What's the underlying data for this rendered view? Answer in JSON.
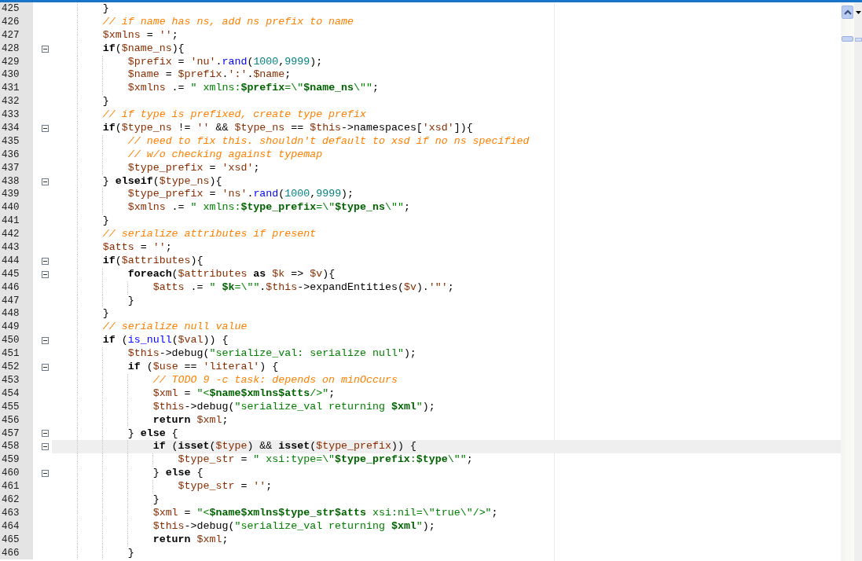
{
  "editor": {
    "lines": [
      {
        "number": "425",
        "fold": false,
        "highlighted": false,
        "tokens": [
          {
            "kind": "plain",
            "text": "        }"
          }
        ]
      },
      {
        "number": "426",
        "fold": false,
        "highlighted": false,
        "tokens": [
          {
            "kind": "comment",
            "text": "        // if name has ns, add ns prefix to name"
          }
        ]
      },
      {
        "number": "427",
        "fold": false,
        "highlighted": false,
        "tokens": [
          {
            "kind": "variable",
            "text": "        $xmlns"
          },
          {
            "kind": "plain",
            "text": " = "
          },
          {
            "kind": "string",
            "text": "''"
          },
          {
            "kind": "plain",
            "text": ";"
          }
        ]
      },
      {
        "number": "428",
        "fold": true,
        "highlighted": false,
        "tokens": [
          {
            "kind": "keyword",
            "text": "        if"
          },
          {
            "kind": "plain",
            "text": "("
          },
          {
            "kind": "variable",
            "text": "$name_ns"
          },
          {
            "kind": "plain",
            "text": "){"
          }
        ]
      },
      {
        "number": "429",
        "fold": false,
        "highlighted": false,
        "tokens": [
          {
            "kind": "variable",
            "text": "            $prefix"
          },
          {
            "kind": "plain",
            "text": " = "
          },
          {
            "kind": "string",
            "text": "'nu'"
          },
          {
            "kind": "plain",
            "text": "."
          },
          {
            "kind": "function",
            "text": "rand"
          },
          {
            "kind": "plain",
            "text": "("
          },
          {
            "kind": "number",
            "text": "1000"
          },
          {
            "kind": "plain",
            "text": ","
          },
          {
            "kind": "number",
            "text": "9999"
          },
          {
            "kind": "plain",
            "text": ");"
          }
        ]
      },
      {
        "number": "430",
        "fold": false,
        "highlighted": false,
        "tokens": [
          {
            "kind": "variable",
            "text": "            $name"
          },
          {
            "kind": "plain",
            "text": " = "
          },
          {
            "kind": "variable",
            "text": "$prefix"
          },
          {
            "kind": "plain",
            "text": "."
          },
          {
            "kind": "string",
            "text": "':'"
          },
          {
            "kind": "plain",
            "text": "."
          },
          {
            "kind": "variable",
            "text": "$name"
          },
          {
            "kind": "plain",
            "text": ";"
          }
        ]
      },
      {
        "number": "431",
        "fold": false,
        "highlighted": false,
        "tokens": [
          {
            "kind": "variable",
            "text": "            $xmlns"
          },
          {
            "kind": "plain",
            "text": " .= "
          },
          {
            "kind": "dstring",
            "text": "\" xmlns:"
          },
          {
            "kind": "interp",
            "text": "$prefix"
          },
          {
            "kind": "dstring",
            "text": "=\\\""
          },
          {
            "kind": "interp",
            "text": "$name_ns"
          },
          {
            "kind": "dstring",
            "text": "\\\"\""
          },
          {
            "kind": "plain",
            "text": ";"
          }
        ]
      },
      {
        "number": "432",
        "fold": false,
        "highlighted": false,
        "tokens": [
          {
            "kind": "plain",
            "text": "        }"
          }
        ]
      },
      {
        "number": "433",
        "fold": false,
        "highlighted": false,
        "tokens": [
          {
            "kind": "comment",
            "text": "        // if type is prefixed, create type prefix"
          }
        ]
      },
      {
        "number": "434",
        "fold": true,
        "highlighted": false,
        "tokens": [
          {
            "kind": "keyword",
            "text": "        if"
          },
          {
            "kind": "plain",
            "text": "("
          },
          {
            "kind": "variable",
            "text": "$type_ns"
          },
          {
            "kind": "plain",
            "text": " != "
          },
          {
            "kind": "string",
            "text": "''"
          },
          {
            "kind": "plain",
            "text": " && "
          },
          {
            "kind": "variable",
            "text": "$type_ns"
          },
          {
            "kind": "plain",
            "text": " == "
          },
          {
            "kind": "variable",
            "text": "$this"
          },
          {
            "kind": "plain",
            "text": "->namespaces["
          },
          {
            "kind": "string",
            "text": "'xsd'"
          },
          {
            "kind": "plain",
            "text": "]){"
          }
        ]
      },
      {
        "number": "435",
        "fold": false,
        "highlighted": false,
        "tokens": [
          {
            "kind": "comment",
            "text": "            // need to fix this. shouldn't default to xsd if no ns specified"
          }
        ]
      },
      {
        "number": "436",
        "fold": false,
        "highlighted": false,
        "tokens": [
          {
            "kind": "comment",
            "text": "            // w/o checking against typemap"
          }
        ]
      },
      {
        "number": "437",
        "fold": false,
        "highlighted": false,
        "tokens": [
          {
            "kind": "variable",
            "text": "            $type_prefix"
          },
          {
            "kind": "plain",
            "text": " = "
          },
          {
            "kind": "string",
            "text": "'xsd'"
          },
          {
            "kind": "plain",
            "text": ";"
          }
        ]
      },
      {
        "number": "438",
        "fold": true,
        "highlighted": false,
        "tokens": [
          {
            "kind": "plain",
            "text": "        } "
          },
          {
            "kind": "keyword",
            "text": "elseif"
          },
          {
            "kind": "plain",
            "text": "("
          },
          {
            "kind": "variable",
            "text": "$type_ns"
          },
          {
            "kind": "plain",
            "text": "){"
          }
        ]
      },
      {
        "number": "439",
        "fold": false,
        "highlighted": false,
        "tokens": [
          {
            "kind": "variable",
            "text": "            $type_prefix"
          },
          {
            "kind": "plain",
            "text": " = "
          },
          {
            "kind": "string",
            "text": "'ns'"
          },
          {
            "kind": "plain",
            "text": "."
          },
          {
            "kind": "function",
            "text": "rand"
          },
          {
            "kind": "plain",
            "text": "("
          },
          {
            "kind": "number",
            "text": "1000"
          },
          {
            "kind": "plain",
            "text": ","
          },
          {
            "kind": "number",
            "text": "9999"
          },
          {
            "kind": "plain",
            "text": ");"
          }
        ]
      },
      {
        "number": "440",
        "fold": false,
        "highlighted": false,
        "tokens": [
          {
            "kind": "variable",
            "text": "            $xmlns"
          },
          {
            "kind": "plain",
            "text": " .= "
          },
          {
            "kind": "dstring",
            "text": "\" xmlns:"
          },
          {
            "kind": "interp",
            "text": "$type_prefix"
          },
          {
            "kind": "dstring",
            "text": "=\\\""
          },
          {
            "kind": "interp",
            "text": "$type_ns"
          },
          {
            "kind": "dstring",
            "text": "\\\"\""
          },
          {
            "kind": "plain",
            "text": ";"
          }
        ]
      },
      {
        "number": "441",
        "fold": false,
        "highlighted": false,
        "tokens": [
          {
            "kind": "plain",
            "text": "        }"
          }
        ]
      },
      {
        "number": "442",
        "fold": false,
        "highlighted": false,
        "tokens": [
          {
            "kind": "comment",
            "text": "        // serialize attributes if present"
          }
        ]
      },
      {
        "number": "443",
        "fold": false,
        "highlighted": false,
        "tokens": [
          {
            "kind": "variable",
            "text": "        $atts"
          },
          {
            "kind": "plain",
            "text": " = "
          },
          {
            "kind": "string",
            "text": "''"
          },
          {
            "kind": "plain",
            "text": ";"
          }
        ]
      },
      {
        "number": "444",
        "fold": true,
        "highlighted": false,
        "tokens": [
          {
            "kind": "keyword",
            "text": "        if"
          },
          {
            "kind": "plain",
            "text": "("
          },
          {
            "kind": "variable",
            "text": "$attributes"
          },
          {
            "kind": "plain",
            "text": "){"
          }
        ]
      },
      {
        "number": "445",
        "fold": true,
        "highlighted": false,
        "tokens": [
          {
            "kind": "keyword",
            "text": "            foreach"
          },
          {
            "kind": "plain",
            "text": "("
          },
          {
            "kind": "variable",
            "text": "$attributes"
          },
          {
            "kind": "keyword",
            "text": " as "
          },
          {
            "kind": "variable",
            "text": "$k"
          },
          {
            "kind": "plain",
            "text": " => "
          },
          {
            "kind": "variable",
            "text": "$v"
          },
          {
            "kind": "plain",
            "text": "){"
          }
        ]
      },
      {
        "number": "446",
        "fold": false,
        "highlighted": false,
        "tokens": [
          {
            "kind": "variable",
            "text": "                $atts"
          },
          {
            "kind": "plain",
            "text": " .= "
          },
          {
            "kind": "dstring",
            "text": "\" "
          },
          {
            "kind": "interp",
            "text": "$k"
          },
          {
            "kind": "dstring",
            "text": "=\\\"\""
          },
          {
            "kind": "plain",
            "text": "."
          },
          {
            "kind": "variable",
            "text": "$this"
          },
          {
            "kind": "plain",
            "text": "->expandEntities("
          },
          {
            "kind": "variable",
            "text": "$v"
          },
          {
            "kind": "plain",
            "text": ")."
          },
          {
            "kind": "string",
            "text": "'\"'"
          },
          {
            "kind": "plain",
            "text": ";"
          }
        ]
      },
      {
        "number": "447",
        "fold": false,
        "highlighted": false,
        "tokens": [
          {
            "kind": "plain",
            "text": "            }"
          }
        ]
      },
      {
        "number": "448",
        "fold": false,
        "highlighted": false,
        "tokens": [
          {
            "kind": "plain",
            "text": "        }"
          }
        ]
      },
      {
        "number": "449",
        "fold": false,
        "highlighted": false,
        "tokens": [
          {
            "kind": "comment",
            "text": "        // serialize null value"
          }
        ]
      },
      {
        "number": "450",
        "fold": true,
        "highlighted": false,
        "tokens": [
          {
            "kind": "keyword",
            "text": "        if"
          },
          {
            "kind": "plain",
            "text": " ("
          },
          {
            "kind": "function",
            "text": "is_null"
          },
          {
            "kind": "plain",
            "text": "("
          },
          {
            "kind": "variable",
            "text": "$val"
          },
          {
            "kind": "plain",
            "text": ")) {"
          }
        ]
      },
      {
        "number": "451",
        "fold": false,
        "highlighted": false,
        "tokens": [
          {
            "kind": "variable",
            "text": "            $this"
          },
          {
            "kind": "plain",
            "text": "->debug("
          },
          {
            "kind": "dstring",
            "text": "\"serialize_val: serialize null\""
          },
          {
            "kind": "plain",
            "text": ");"
          }
        ]
      },
      {
        "number": "452",
        "fold": true,
        "highlighted": false,
        "tokens": [
          {
            "kind": "keyword",
            "text": "            if"
          },
          {
            "kind": "plain",
            "text": " ("
          },
          {
            "kind": "variable",
            "text": "$use"
          },
          {
            "kind": "plain",
            "text": " == "
          },
          {
            "kind": "string",
            "text": "'literal'"
          },
          {
            "kind": "plain",
            "text": ") {"
          }
        ]
      },
      {
        "number": "453",
        "fold": false,
        "highlighted": false,
        "tokens": [
          {
            "kind": "comment",
            "text": "                // TODO 9 -c task: depends on minOccurs"
          }
        ]
      },
      {
        "number": "454",
        "fold": false,
        "highlighted": false,
        "tokens": [
          {
            "kind": "variable",
            "text": "                $xml"
          },
          {
            "kind": "plain",
            "text": " = "
          },
          {
            "kind": "dstring",
            "text": "\"<"
          },
          {
            "kind": "interp",
            "text": "$name$xmlns$atts"
          },
          {
            "kind": "dstring",
            "text": "/>\""
          },
          {
            "kind": "plain",
            "text": ";"
          }
        ]
      },
      {
        "number": "455",
        "fold": false,
        "highlighted": false,
        "tokens": [
          {
            "kind": "variable",
            "text": "                $this"
          },
          {
            "kind": "plain",
            "text": "->debug("
          },
          {
            "kind": "dstring",
            "text": "\"serialize_val returning "
          },
          {
            "kind": "interp",
            "text": "$xml"
          },
          {
            "kind": "dstring",
            "text": "\""
          },
          {
            "kind": "plain",
            "text": ");"
          }
        ]
      },
      {
        "number": "456",
        "fold": false,
        "highlighted": false,
        "tokens": [
          {
            "kind": "keyword",
            "text": "                return "
          },
          {
            "kind": "variable",
            "text": "$xml"
          },
          {
            "kind": "plain",
            "text": ";"
          }
        ]
      },
      {
        "number": "457",
        "fold": true,
        "highlighted": false,
        "tokens": [
          {
            "kind": "plain",
            "text": "            } "
          },
          {
            "kind": "keyword",
            "text": "else"
          },
          {
            "kind": "plain",
            "text": " {"
          }
        ]
      },
      {
        "number": "458",
        "fold": true,
        "highlighted": true,
        "tokens": [
          {
            "kind": "keyword",
            "text": "                if"
          },
          {
            "kind": "plain",
            "text": " ("
          },
          {
            "kind": "keyword",
            "text": "isset"
          },
          {
            "kind": "plain",
            "text": "("
          },
          {
            "kind": "variable",
            "text": "$type"
          },
          {
            "kind": "plain",
            "text": ") && "
          },
          {
            "kind": "keyword",
            "text": "isset"
          },
          {
            "kind": "plain",
            "text": "("
          },
          {
            "kind": "variable",
            "text": "$type_prefix"
          },
          {
            "kind": "plain",
            "text": ")) {"
          }
        ]
      },
      {
        "number": "459",
        "fold": false,
        "highlighted": false,
        "tokens": [
          {
            "kind": "variable",
            "text": "                    $type_str"
          },
          {
            "kind": "plain",
            "text": " = "
          },
          {
            "kind": "dstring",
            "text": "\" xsi:type=\\\""
          },
          {
            "kind": "interp",
            "text": "$type_prefix"
          },
          {
            "kind": "dstring",
            "text": ":"
          },
          {
            "kind": "interp",
            "text": "$type"
          },
          {
            "kind": "dstring",
            "text": "\\\"\""
          },
          {
            "kind": "plain",
            "text": ";"
          }
        ]
      },
      {
        "number": "460",
        "fold": true,
        "highlighted": false,
        "tokens": [
          {
            "kind": "plain",
            "text": "                } "
          },
          {
            "kind": "keyword",
            "text": "else"
          },
          {
            "kind": "plain",
            "text": " {"
          }
        ]
      },
      {
        "number": "461",
        "fold": false,
        "highlighted": false,
        "tokens": [
          {
            "kind": "variable",
            "text": "                    $type_str"
          },
          {
            "kind": "plain",
            "text": " = "
          },
          {
            "kind": "string",
            "text": "''"
          },
          {
            "kind": "plain",
            "text": ";"
          }
        ]
      },
      {
        "number": "462",
        "fold": false,
        "highlighted": false,
        "tokens": [
          {
            "kind": "plain",
            "text": "                }"
          }
        ]
      },
      {
        "number": "463",
        "fold": false,
        "highlighted": false,
        "tokens": [
          {
            "kind": "variable",
            "text": "                $xml"
          },
          {
            "kind": "plain",
            "text": " = "
          },
          {
            "kind": "dstring",
            "text": "\"<"
          },
          {
            "kind": "interp",
            "text": "$name$xmlns$type_str$atts"
          },
          {
            "kind": "dstring",
            "text": " xsi:nil=\\\"true\\\"/>\""
          },
          {
            "kind": "plain",
            "text": ";"
          }
        ]
      },
      {
        "number": "464",
        "fold": false,
        "highlighted": false,
        "tokens": [
          {
            "kind": "variable",
            "text": "                $this"
          },
          {
            "kind": "plain",
            "text": "->debug("
          },
          {
            "kind": "dstring",
            "text": "\"serialize_val returning "
          },
          {
            "kind": "interp",
            "text": "$xml"
          },
          {
            "kind": "dstring",
            "text": "\""
          },
          {
            "kind": "plain",
            "text": ");"
          }
        ]
      },
      {
        "number": "465",
        "fold": false,
        "highlighted": false,
        "tokens": [
          {
            "kind": "keyword",
            "text": "                return "
          },
          {
            "kind": "variable",
            "text": "$xml"
          },
          {
            "kind": "plain",
            "text": ";"
          }
        ]
      },
      {
        "number": "466",
        "fold": false,
        "highlighted": false,
        "tokens": [
          {
            "kind": "plain",
            "text": "            }"
          }
        ]
      }
    ]
  }
}
